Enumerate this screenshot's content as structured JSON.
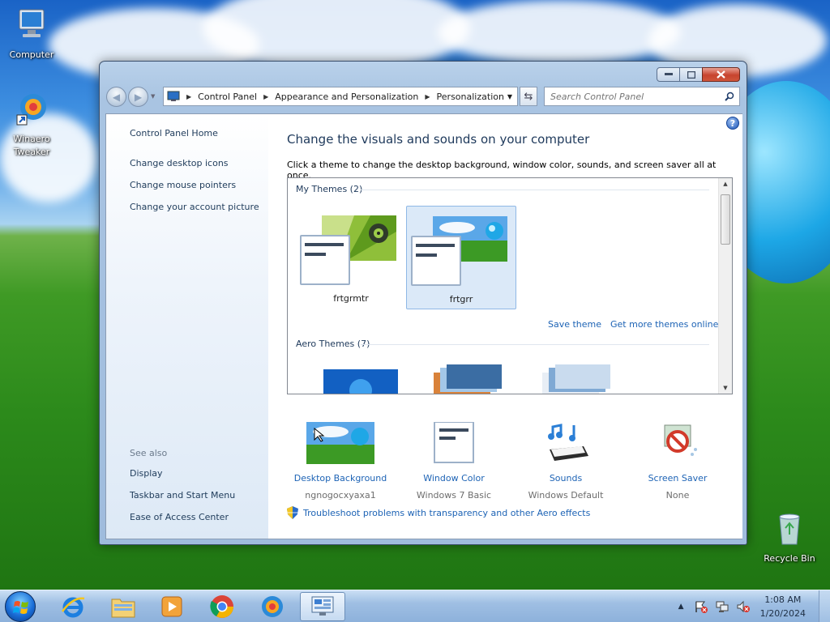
{
  "desktop": {
    "icons": [
      {
        "label": "Computer"
      },
      {
        "label": "Winaero Tweaker"
      },
      {
        "label": "Recycle Bin"
      }
    ]
  },
  "window": {
    "address": {
      "crumbs": [
        "Control Panel",
        "Appearance and Personalization",
        "Personalization"
      ]
    },
    "search": {
      "placeholder": "Search Control Panel"
    },
    "left_pane": {
      "links": [
        "Control Panel Home",
        "Change desktop icons",
        "Change mouse pointers",
        "Change your account picture"
      ],
      "see_also_label": "See also",
      "see_also": [
        "Display",
        "Taskbar and Start Menu",
        "Ease of Access Center"
      ]
    },
    "main": {
      "title": "Change the visuals and sounds on your computer",
      "subtitle": "Click a theme to change the desktop background, window color, sounds, and screen saver all at once.",
      "my_themes_header": "My Themes (2)",
      "themes": [
        {
          "name": "frtgrmtr",
          "selected": false
        },
        {
          "name": "frtgrr",
          "selected": true
        }
      ],
      "save_theme": "Save theme",
      "get_more": "Get more themes online",
      "aero_header": "Aero Themes (7)",
      "bottom": [
        {
          "label": "Desktop Background",
          "value": "ngnogocxyaxa1",
          "icon": "desktop-background-icon"
        },
        {
          "label": "Window Color",
          "value": "Windows 7 Basic",
          "icon": "window-color-icon"
        },
        {
          "label": "Sounds",
          "value": "Windows Default",
          "icon": "sounds-icon"
        },
        {
          "label": "Screen Saver",
          "value": "None",
          "icon": "screen-saver-icon"
        }
      ],
      "troubleshoot": "Troubleshoot problems with transparency and other Aero effects"
    }
  },
  "taskbar": {
    "time": "1:08 AM",
    "date": "1/20/2024"
  },
  "colors": {
    "link": "#1d63b5",
    "title": "#1e395b",
    "selection": "#dbe9f8"
  }
}
